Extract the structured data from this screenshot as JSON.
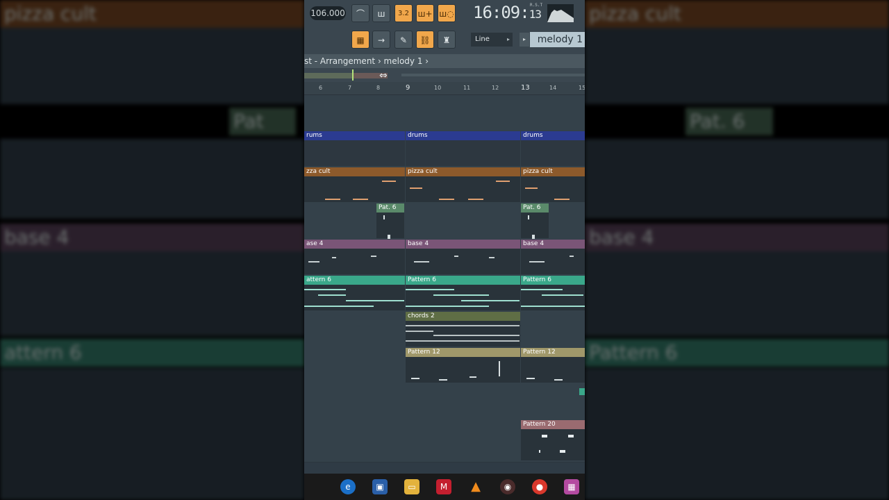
{
  "toolbar": {
    "tempo": "106.000",
    "clock_main": "16:09",
    "clock_sec": "13",
    "clock_label": "R.S.T",
    "mode_label": "Line",
    "pattern_label": "melody 1",
    "buttons_row1": [
      "metronome-icon",
      "wait-icon",
      "3.2",
      "step-icon",
      "loop-icon"
    ],
    "buttons_row2": [
      "piano-icon",
      "arrow-icon",
      "brush-icon",
      "link-icon",
      "stamp-icon"
    ]
  },
  "breadcrumb": {
    "text": "st - Arrangement › melody 1 ›"
  },
  "ruler": {
    "bars": [
      "6",
      "7",
      "8",
      "9",
      "10",
      "11",
      "12",
      "13",
      "14",
      "15"
    ]
  },
  "tracks": [
    {
      "name": "track-1",
      "clips": []
    },
    {
      "name": "track-2",
      "clips": [
        {
          "label": "rums",
          "color": "#2b3b91"
        },
        {
          "label": "drums",
          "color": "#2b3b91"
        },
        {
          "label": "drums",
          "color": "#2b3b91"
        }
      ]
    },
    {
      "name": "track-3",
      "clips": [
        {
          "label": "zza cult",
          "color": "#8d5a2b"
        },
        {
          "label": "pizza cult",
          "color": "#8d5a2b"
        },
        {
          "label": "pizza cult",
          "color": "#8d5a2b"
        }
      ]
    },
    {
      "name": "track-4",
      "clips": [
        {
          "label": "Pat. 6",
          "color": "#5a8a6a"
        },
        {
          "label": "Pat. 6",
          "color": "#5a8a6a"
        }
      ]
    },
    {
      "name": "track-5",
      "clips": [
        {
          "label": "ase 4",
          "color": "#7a5577"
        },
        {
          "label": "base 4",
          "color": "#7a5577"
        },
        {
          "label": "base 4",
          "color": "#7a5577"
        }
      ]
    },
    {
      "name": "track-6",
      "clips": [
        {
          "label": "attern 6",
          "color": "#3aa88a"
        },
        {
          "label": "Pattern 6",
          "color": "#3aa88a"
        },
        {
          "label": "Pattern 6",
          "color": "#3aa88a"
        }
      ]
    },
    {
      "name": "track-7",
      "clips": [
        {
          "label": "chords 2",
          "color": "#5f6e45"
        }
      ]
    },
    {
      "name": "track-8",
      "clips": [
        {
          "label": "Pattern 12",
          "color": "#a0986a"
        },
        {
          "label": "Pattern 12",
          "color": "#a0986a"
        }
      ]
    },
    {
      "name": "track-9",
      "clips": []
    },
    {
      "name": "track-10",
      "clips": [
        {
          "label": "Pattern 20",
          "color": "#9a6b70"
        }
      ]
    }
  ],
  "background": {
    "left_labels": [
      "pizza cult",
      "Pat",
      "base 4",
      "attern 6"
    ],
    "right_labels": [
      "pizza cult",
      "Pat. 6",
      "base 4",
      "Pattern 6"
    ]
  },
  "taskbar": {
    "icons": [
      "edge-icon",
      "store-icon",
      "file-explorer-icon",
      "mcafee-icon",
      "vlc-icon",
      "media-icon",
      "chrome-icon",
      "app-icon"
    ]
  }
}
